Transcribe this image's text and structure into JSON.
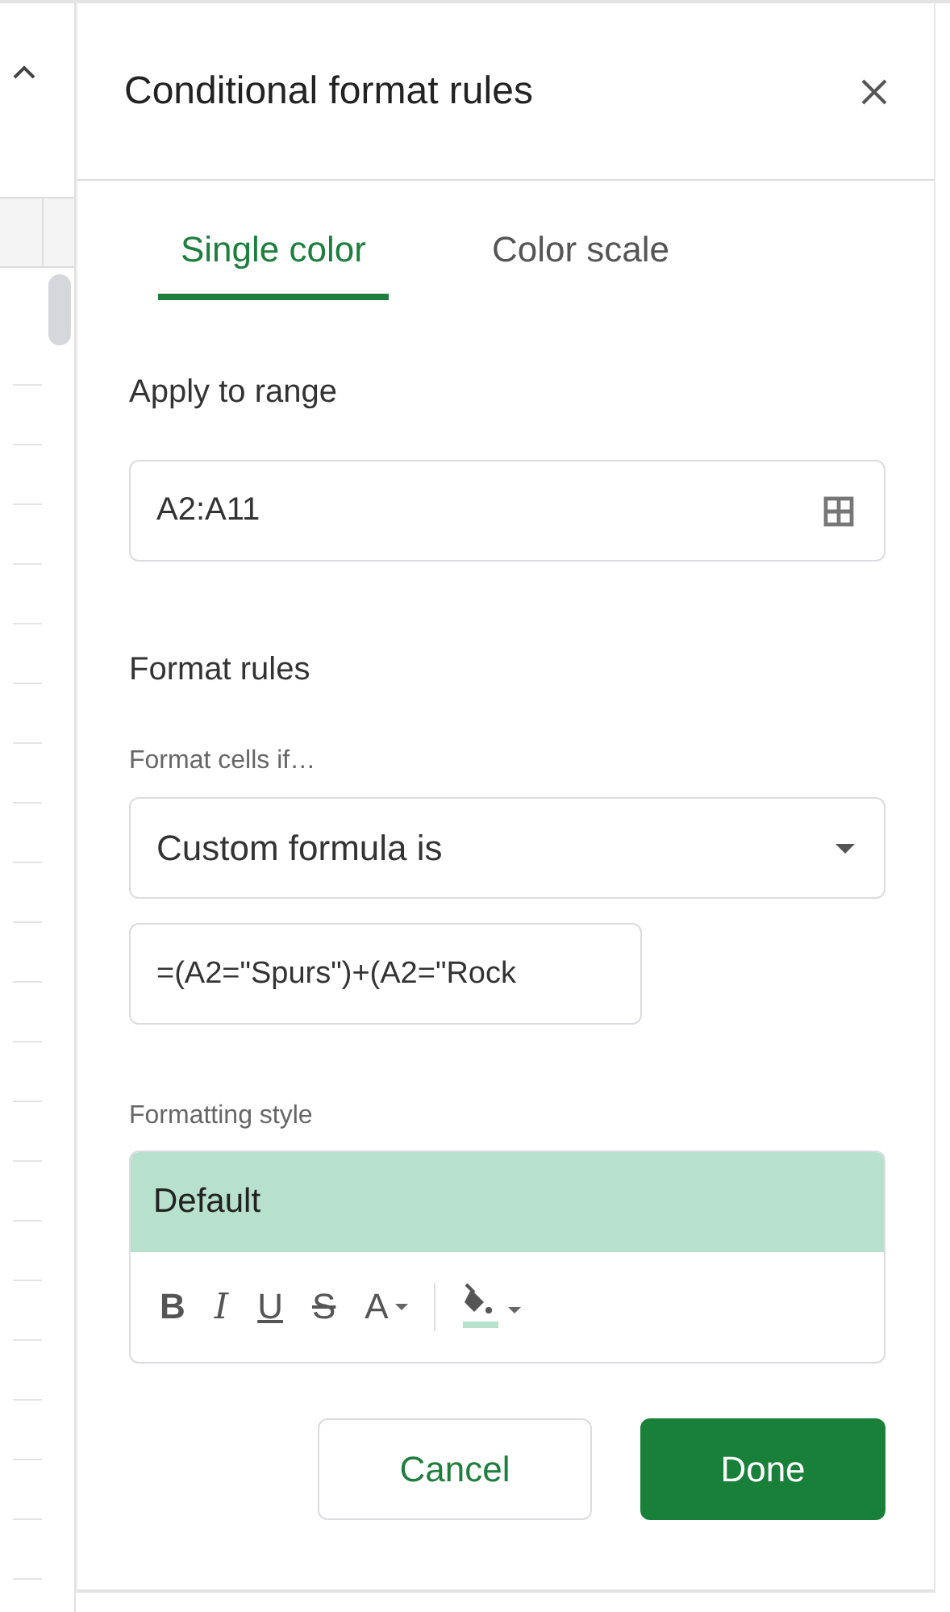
{
  "panel": {
    "title": "Conditional format rules"
  },
  "tabs": [
    {
      "label": "Single color",
      "selected": true
    },
    {
      "label": "Color scale",
      "selected": false
    }
  ],
  "range": {
    "heading": "Apply to range",
    "value": "A2:A11"
  },
  "rules": {
    "heading": "Format rules",
    "condition_label": "Format cells if…",
    "condition": "Custom formula is",
    "formula": "=(A2=\"Spurs\")+(A2=\"Rock"
  },
  "style": {
    "heading": "Formatting style",
    "preview": "Default",
    "toolbar": [
      {
        "kind": "bold",
        "label": "B"
      },
      {
        "kind": "italic",
        "label": "I"
      },
      {
        "kind": "underline",
        "label": "U"
      },
      {
        "kind": "strike",
        "label": "S"
      },
      {
        "kind": "text-color",
        "label": "A"
      },
      {
        "kind": "fill"
      }
    ]
  },
  "buttons": [
    {
      "kind": "secondary",
      "label": "Cancel"
    },
    {
      "kind": "primary",
      "label": "Done"
    }
  ]
}
